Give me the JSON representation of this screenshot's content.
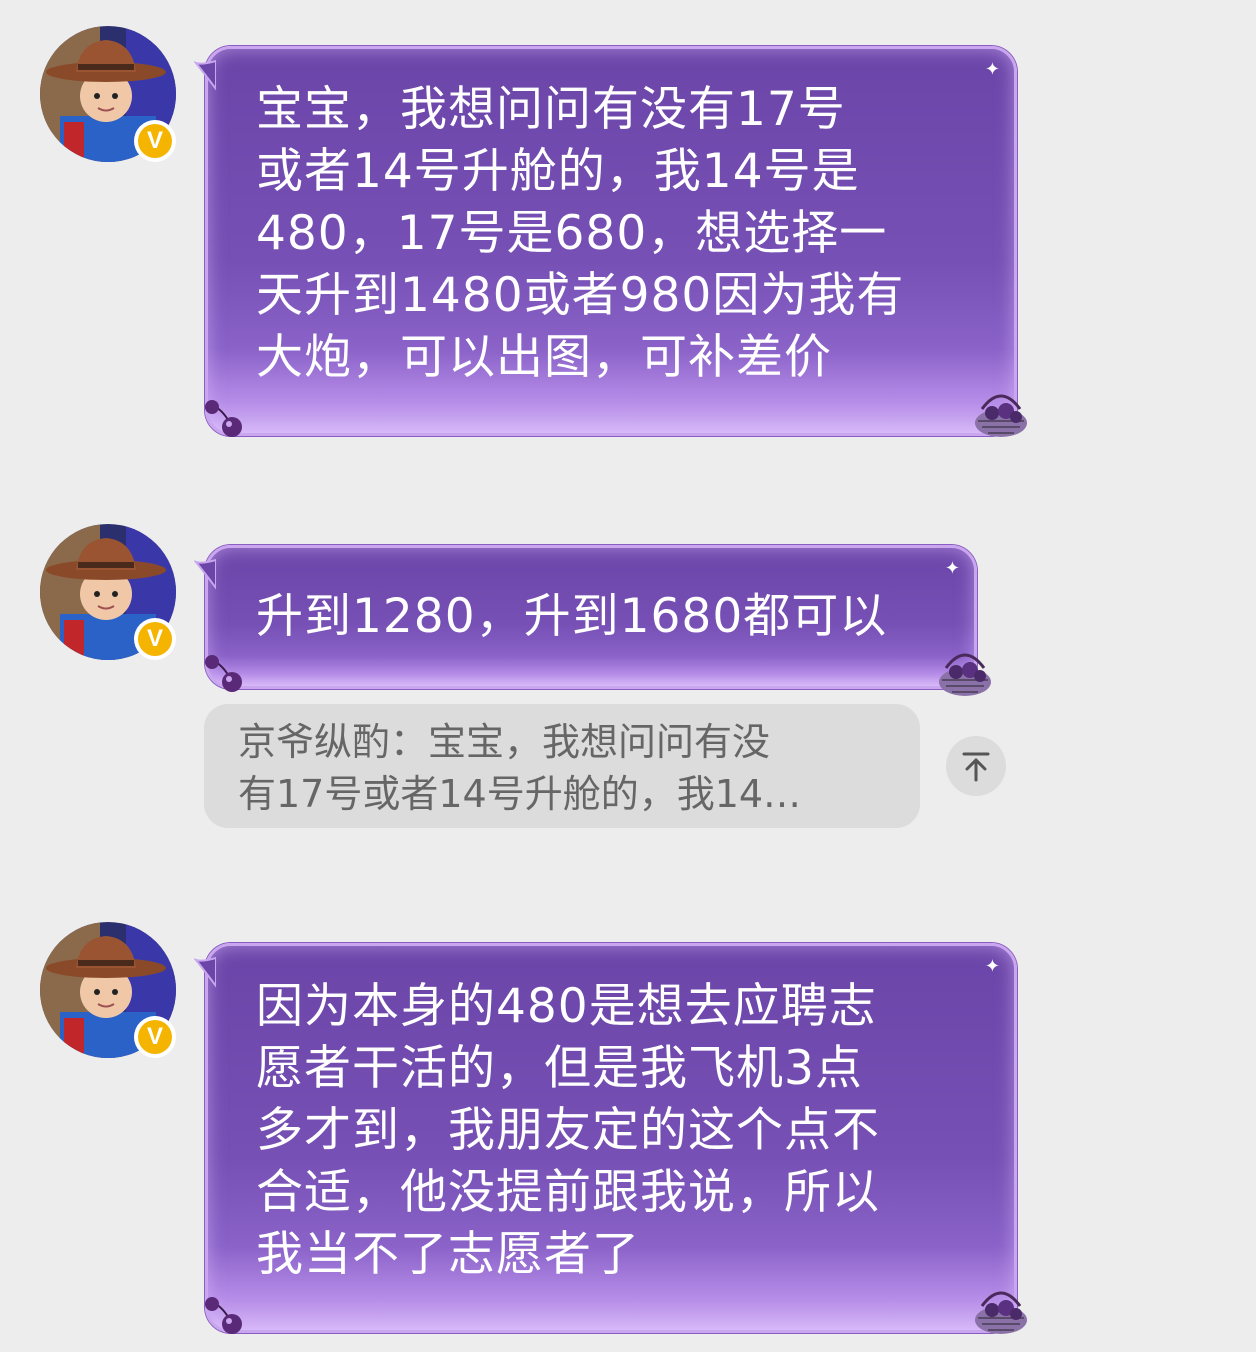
{
  "messages": [
    {
      "id": "msg-1",
      "text": "宝宝，我想问问有没有17号\n或者14号升舱的，我14号是\n480，17号是680，想选择一\n天升到1480或者980因为我有\n大炮，可以出图，可补差价"
    },
    {
      "id": "msg-2",
      "text": "升到1280，升到1680都可以",
      "quote": {
        "text": "京爷纵酌：宝宝，我想问问有没\n有17号或者14号升舱的，我14…"
      }
    },
    {
      "id": "msg-3",
      "text": "因为本身的480是想去应聘志\n愿者干活的，但是我飞机3点\n多才到，我朋友定的这个点不\n合适，他没提前跟我说，所以\n我当不了志愿者了"
    }
  ],
  "avatar": {
    "badge": "V",
    "badge_color": "#f4b400"
  },
  "icons": {
    "scroll_to_quote": "arrow-up-to-top-icon",
    "bubble_decoration_left": "cherry-icon",
    "bubble_decoration_right": "grape-basket-icon",
    "bubble_decoration_sparkle": "sparkle-icon"
  },
  "colors": {
    "background": "#ededed",
    "bubble": "#7650b4",
    "bubble_border": "#c9a6ee",
    "bubble_text": "#ffffff",
    "quote_bg": "#dcdcdc",
    "quote_text": "#666666"
  }
}
